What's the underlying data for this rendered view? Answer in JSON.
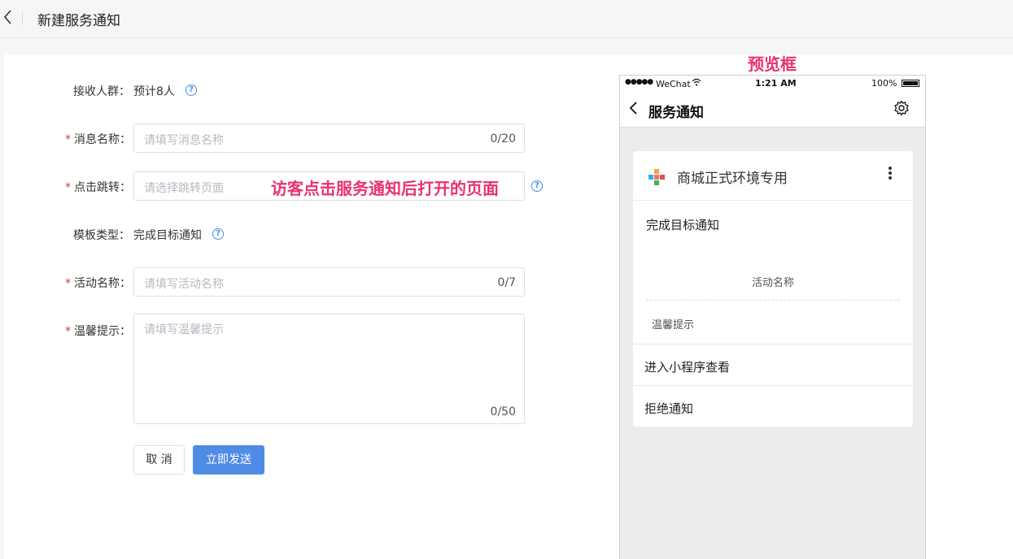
{
  "header": {
    "title": "新建服务通知"
  },
  "form": {
    "recipients": {
      "label": "接收人群：",
      "value": "预计8人"
    },
    "message_name": {
      "label": "消息名称：",
      "placeholder": "请填写消息名称",
      "count": "0/20"
    },
    "click_jump": {
      "label": "点击跳转：",
      "placeholder": "请选择跳转页面"
    },
    "template_type": {
      "label": "模板类型：",
      "value": "完成目标通知"
    },
    "activity_name": {
      "label": "活动名称：",
      "placeholder": "请填写活动名称",
      "count": "0/7"
    },
    "tip": {
      "label": "温馨提示：",
      "placeholder": "请填写温馨提示",
      "count": "0/50"
    },
    "required_mark": "*",
    "cancel_label": "取 消",
    "send_label": "立即发送"
  },
  "annotation": {
    "jump_note": "访客点击服务通知后打开的页面",
    "preview_title": "预览框"
  },
  "phone": {
    "status": {
      "signal": "●●●●●",
      "carrier": "WeChat",
      "time": "1:21 AM",
      "battery": "100%"
    },
    "nav_title": "服务通知",
    "card": {
      "shop_name": "商城正式环境专用",
      "template_name": "完成目标通知",
      "activity_name": "活动名称",
      "tip": "温馨提示",
      "enter_label": "进入小程序查看",
      "refuse_label": "拒绝通知"
    }
  },
  "icons": {
    "help": "question-circle-icon",
    "back": "chevron-left-icon",
    "gear": "gear-icon",
    "more": "more-vertical-icon",
    "wifi": "wifi-icon",
    "battery": "battery-icon"
  },
  "colors": {
    "accent": "#4f8ce8",
    "annotation": "#e8336d",
    "required": "#e5302d"
  }
}
